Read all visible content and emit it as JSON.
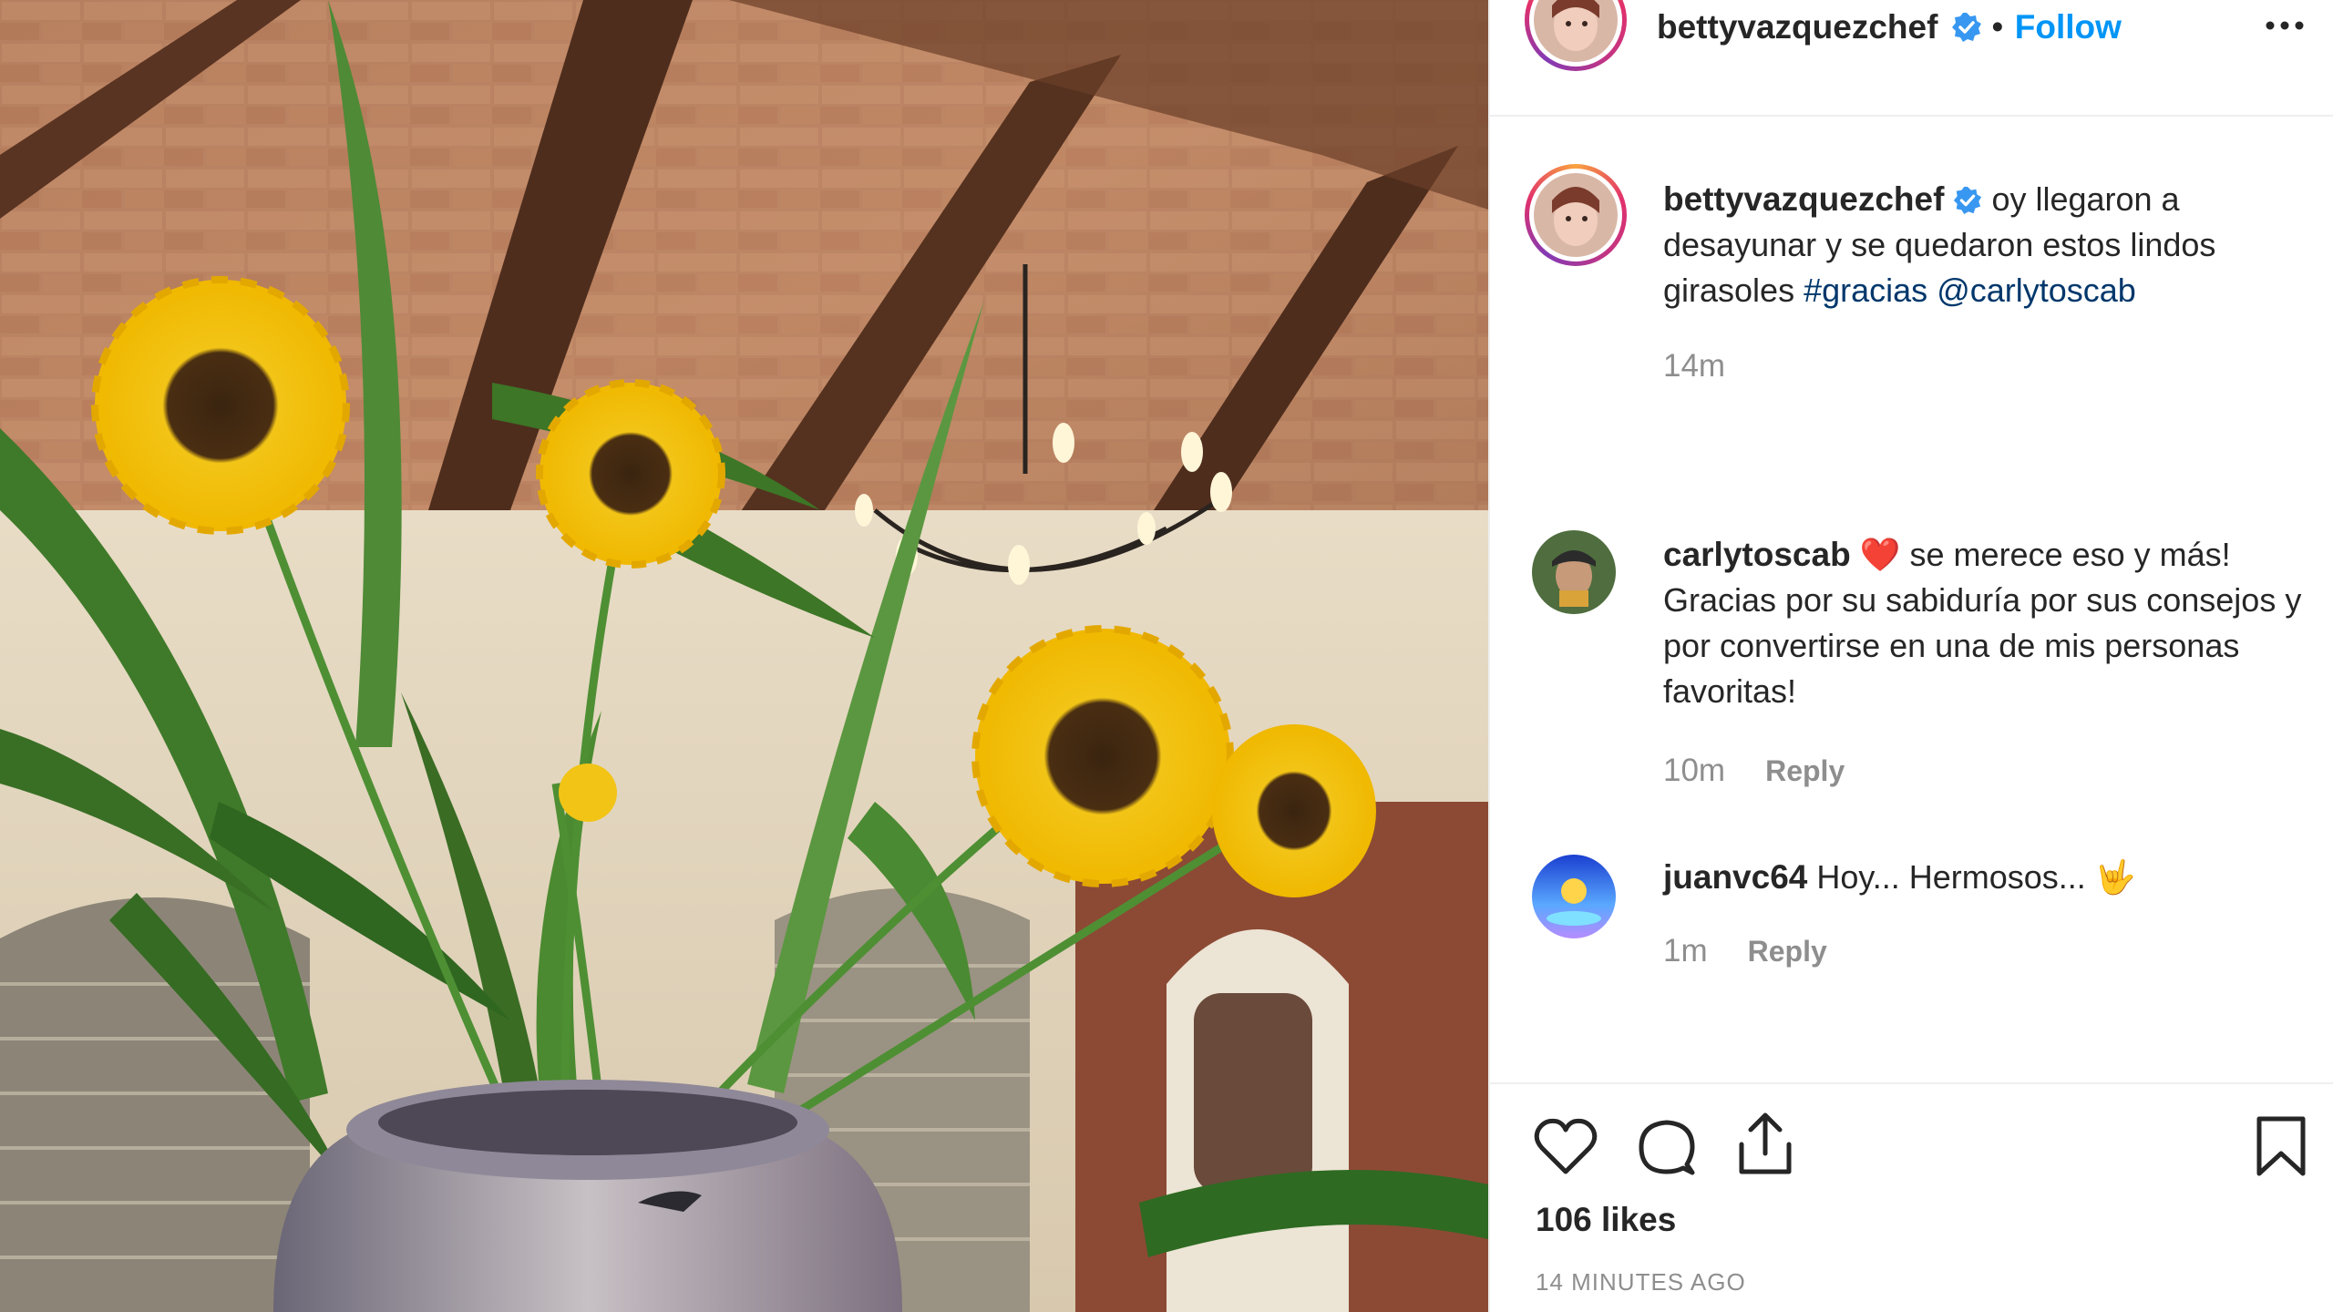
{
  "header": {
    "username": "bettyvazquezchef",
    "separator": "•",
    "follow_label": "Follow"
  },
  "comments": [
    {
      "username": "bettyvazquezchef",
      "verified": true,
      "text": "oy llegaron a desayunar y se quedaron estos lindos girasoles",
      "hashtag": "#gracias",
      "mention": "@carlytoscab",
      "time": "14m"
    },
    {
      "username": "carlytoscab",
      "emoji": "❤️",
      "text": "se merece eso y más! Gracias por su sabiduría por sus consejos y por convertirse en una de mis personas favoritas!",
      "time": "10m",
      "reply_label": "Reply"
    },
    {
      "username": "juanvc64",
      "text": "Hoy... Hermosos...",
      "emoji": "🤟",
      "time": "1m",
      "reply_label": "Reply"
    }
  ],
  "footer": {
    "likes": "106 likes",
    "time_ago": "14 MINUTES AGO"
  },
  "icons": [
    "heart-icon",
    "comment-icon",
    "share-icon",
    "bookmark-icon",
    "more-icon",
    "verified-icon"
  ],
  "colors": {
    "link_blue": "#0095f6",
    "tag_blue": "#00376b",
    "muted": "#8e8e8e",
    "text": "#262626"
  }
}
